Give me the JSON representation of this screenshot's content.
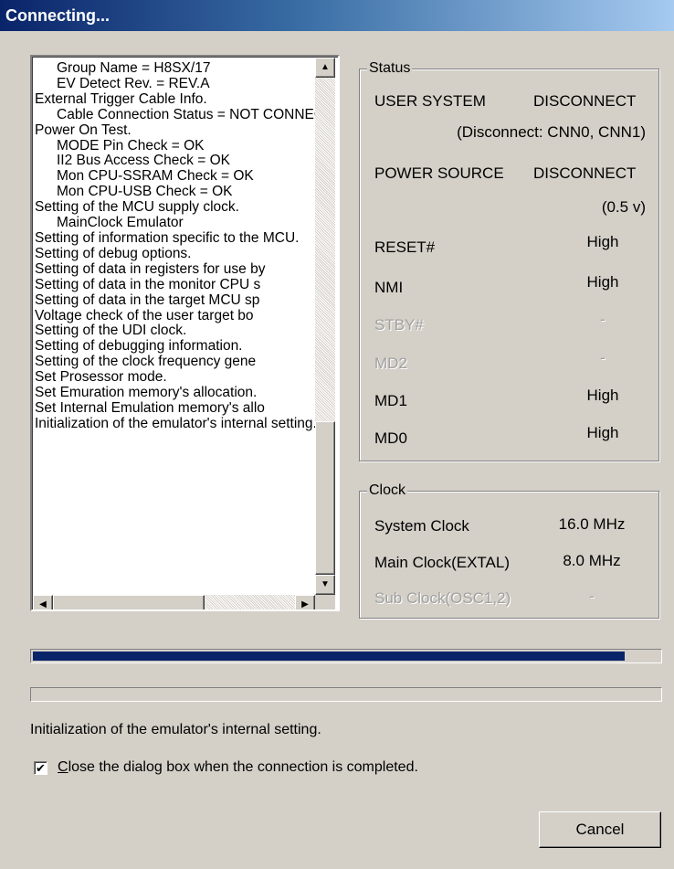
{
  "window": {
    "title": "Connecting..."
  },
  "log": {
    "lines": [
      {
        "text": "Group Name        = H8SX/17",
        "indent": true
      },
      {
        "text": "EV Detect Rev.      = REV.A",
        "indent": true
      },
      {
        "text": "External Trigger Cable Info.",
        "indent": false
      },
      {
        "text": "Cable Connection Status = NOT CONNECT",
        "indent": true
      },
      {
        "text": "Power On Test.",
        "indent": false
      },
      {
        "text": "MODE Pin Check       = OK",
        "indent": true
      },
      {
        "text": "II2 Bus Access Check   = OK",
        "indent": true
      },
      {
        "text": "Mon CPU-SSRAM Check     = OK",
        "indent": true
      },
      {
        "text": "Mon CPU-USB Check      = OK",
        "indent": true
      },
      {
        "text": "Setting of the MCU supply clock.",
        "indent": false
      },
      {
        "text": "MainClock Emulator",
        "indent": true
      },
      {
        "text": "Setting of information specific to the MCU.",
        "indent": false
      },
      {
        "text": "Setting of debug options.",
        "indent": false
      },
      {
        "text": "Setting of data in registers for use by",
        "indent": false
      },
      {
        "text": "Setting of data in the monitor CPU s",
        "indent": false
      },
      {
        "text": "Setting of data in the target MCU sp",
        "indent": false
      },
      {
        "text": "Voltage check of the user target bo",
        "indent": false
      },
      {
        "text": "Setting of the UDI clock.",
        "indent": false
      },
      {
        "text": "Setting of debugging information.",
        "indent": false
      },
      {
        "text": "Setting of the clock frequency gene",
        "indent": false
      },
      {
        "text": "Set Prosessor mode.",
        "indent": false
      },
      {
        "text": "Set Emuration memory's allocation.",
        "indent": false
      },
      {
        "text": "Set Internal Emulation memory's allo",
        "indent": false
      },
      {
        "text": "Initialization of the emulator's internal setting.",
        "indent": false
      }
    ]
  },
  "status": {
    "title": "Status",
    "user_system_label": "USER SYSTEM",
    "user_system_value": "DISCONNECT",
    "user_system_detail": "(Disconnect: CNN0, CNN1)",
    "power_source_label": "POWER SOURCE",
    "power_source_value": "DISCONNECT",
    "power_source_detail": "(0.5 v)",
    "signals": [
      {
        "label": "RESET#",
        "value": "High",
        "enabled": true
      },
      {
        "label": "NMI",
        "value": "High",
        "enabled": true
      },
      {
        "label": "STBY#",
        "value": "-",
        "enabled": false
      },
      {
        "label": "MD2",
        "value": "-",
        "enabled": false
      },
      {
        "label": "MD1",
        "value": "High",
        "enabled": true
      },
      {
        "label": "MD0",
        "value": "High",
        "enabled": true
      }
    ]
  },
  "clock": {
    "title": "Clock",
    "rows": [
      {
        "label": "System Clock",
        "value": "16.0 MHz",
        "enabled": true
      },
      {
        "label": "Main Clock(EXTAL)",
        "value": "8.0 MHz",
        "enabled": true
      },
      {
        "label": "Sub Clock(OSC1,2)",
        "value": "-",
        "enabled": false
      }
    ]
  },
  "progress": {
    "overall_fraction": 0.945,
    "step_fraction": 0.0,
    "fill_color": "#0a246a"
  },
  "status_message": "Initialization of the emulator's internal setting.",
  "close_checkbox": {
    "checked": true,
    "mark": "✔",
    "label_first": "C",
    "label_rest": "lose the dialog box when the connection is completed."
  },
  "cancel_button": {
    "label": "Cancel"
  }
}
